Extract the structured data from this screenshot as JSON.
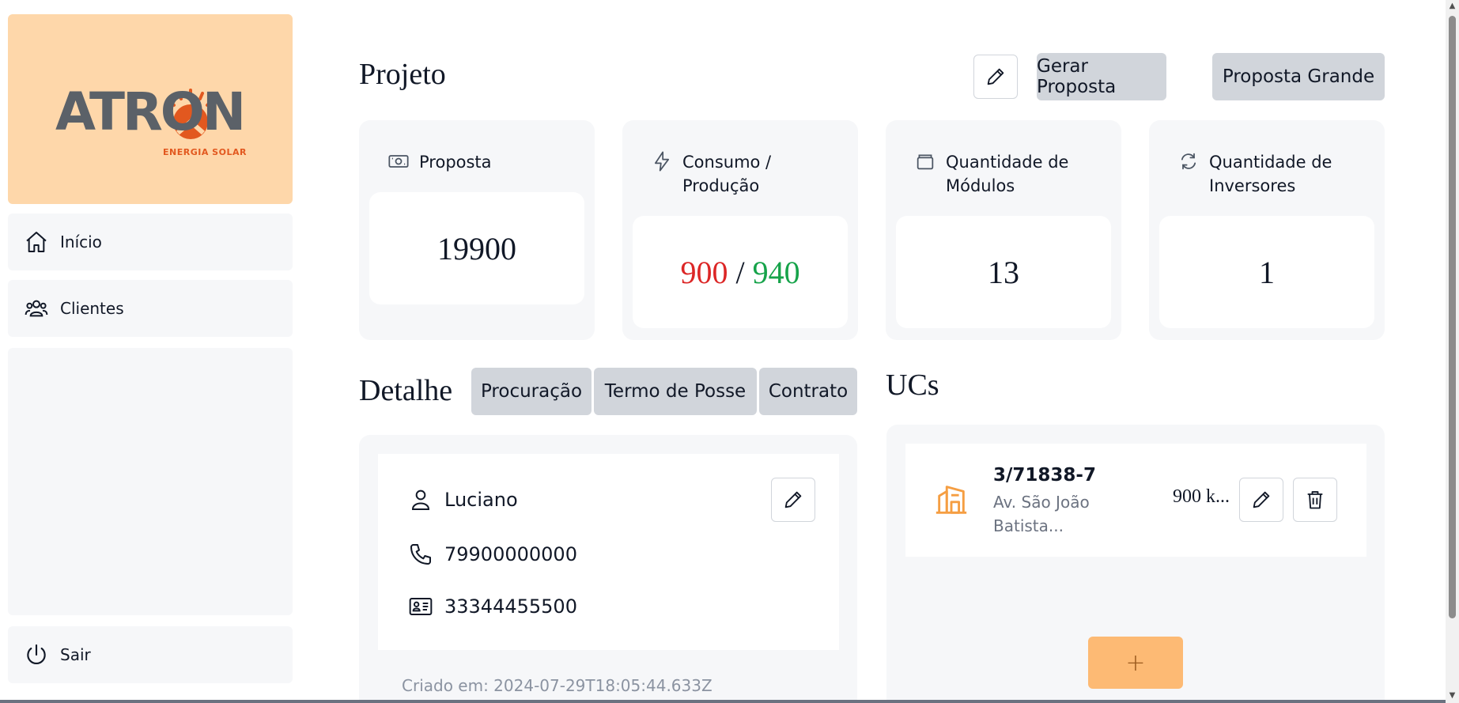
{
  "sidebar": {
    "logo": {
      "word": "ATRON",
      "tagline": "ENERGIA SOLAR"
    },
    "items": [
      {
        "label": "Início",
        "icon": "home-icon"
      },
      {
        "label": "Clientes",
        "icon": "users-icon"
      }
    ],
    "logout": {
      "label": "Sair",
      "icon": "power-icon"
    }
  },
  "projeto": {
    "title": "Projeto",
    "buttons": {
      "gerar": "Gerar Proposta",
      "grande": "Proposta Grande"
    }
  },
  "cards": [
    {
      "label": "Proposta",
      "icon": "money-icon",
      "value": "19900"
    },
    {
      "label": "Consumo / Produção",
      "icon": "lightning-icon",
      "consumo": "900",
      "separator": "/",
      "producao": "940"
    },
    {
      "label": "Quantidade de Módulos",
      "icon": "module-icon",
      "value": "13"
    },
    {
      "label": "Quantidade de Inversores",
      "icon": "refresh-icon",
      "value": "1"
    }
  ],
  "detalhe": {
    "title": "Detalhe",
    "tabs": [
      "Procuração",
      "Termo de Posse",
      "Contrato"
    ],
    "name": "Luciano",
    "phone": "79900000000",
    "document": "33344455500",
    "created": "Criado em: 2024-07-29T18:05:44.633Z"
  },
  "ucs": {
    "title": "UCs",
    "items": [
      {
        "code": "3/71838-7",
        "address": "Av. São João Batista...",
        "consumption": "900 k..."
      }
    ],
    "add_label": "+"
  },
  "colors": {
    "accent": "#fdba74",
    "logo_bg": "#fed7aa",
    "consumo": "#dc2626",
    "producao": "#16a34a",
    "building_icon": "#f59e42"
  }
}
